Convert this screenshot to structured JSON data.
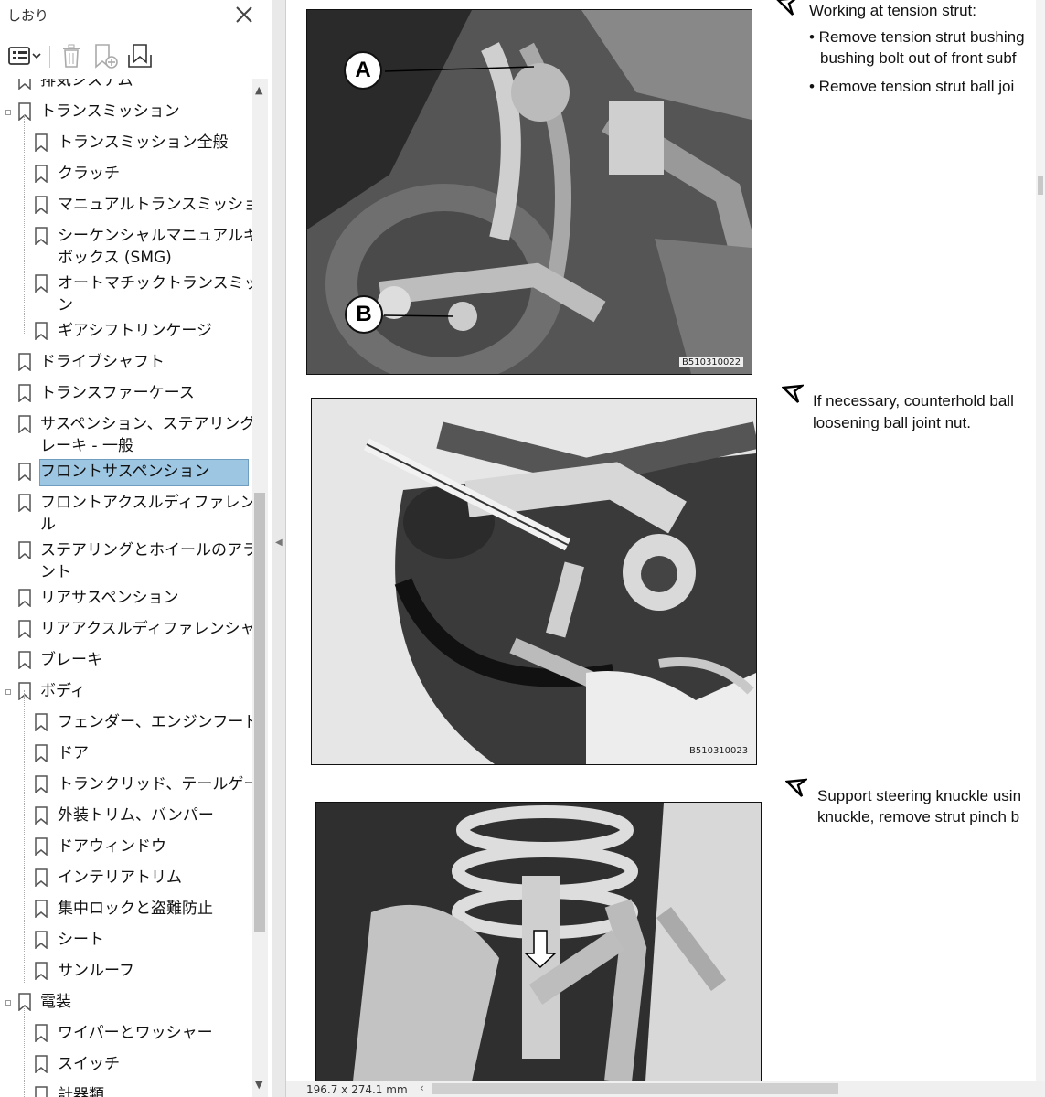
{
  "bookmarks_panel": {
    "title": "しおり",
    "close_icon": "close-icon",
    "toolbar": [
      "options-menu-icon",
      "delete-bookmark-icon",
      "new-bookmark-icon",
      "expand-bookmark-icon"
    ],
    "items": [
      {
        "label": "トランスミッション",
        "level": 0,
        "expandable": true
      },
      {
        "label": "トランスミッション全般",
        "level": 1
      },
      {
        "label": "クラッチ",
        "level": 1
      },
      {
        "label": "マニュアルトランスミッション",
        "level": 1
      },
      {
        "label": "シーケンシャルマニュアルギア",
        "label2": "ボックス (SMG)",
        "level": 1
      },
      {
        "label": "オートマチックトランスミッショ",
        "label2": "ン",
        "level": 1
      },
      {
        "label": "ギアシフトリンケージ",
        "level": 1
      },
      {
        "label": "ドライブシャフト",
        "level": 0
      },
      {
        "label": "トランスファーケース",
        "level": 0
      },
      {
        "label": "サスペンション、ステアリング、ブ",
        "label2": "レーキ - 一般",
        "level": 0
      },
      {
        "label": "フロントサスペンション",
        "level": 0,
        "selected": true
      },
      {
        "label": "フロントアクスルディファレンシャ",
        "label2": "ル",
        "level": 0
      },
      {
        "label": "ステアリングとホイールのアライメ",
        "label2": "ント",
        "level": 0
      },
      {
        "label": "リアサスペンション",
        "level": 0
      },
      {
        "label": "リアアクスルディファレンシャル",
        "level": 0
      },
      {
        "label": "ブレーキ",
        "level": 0
      },
      {
        "label": "ボディ",
        "level": 0,
        "expandable": true
      },
      {
        "label": "フェンダー、エンジンフード",
        "level": 1
      },
      {
        "label": "ドア",
        "level": 1
      },
      {
        "label": "トランクリッド、テールゲート",
        "level": 1
      },
      {
        "label": "外装トリム、バンパー",
        "level": 1
      },
      {
        "label": "ドアウィンドウ",
        "level": 1
      },
      {
        "label": "インテリアトリム",
        "level": 1
      },
      {
        "label": "集中ロックと盗難防止",
        "level": 1
      },
      {
        "label": "シート",
        "level": 1
      },
      {
        "label": "サンルーフ",
        "level": 1
      },
      {
        "label": "電装",
        "level": 0,
        "expandable": true
      },
      {
        "label": "ワイパーとワッシャー",
        "level": 1
      },
      {
        "label": "スイッチ",
        "level": 1
      },
      {
        "label": "計器類",
        "level": 1
      }
    ]
  },
  "document": {
    "figures": [
      {
        "code": "B510310022",
        "callouts": [
          "A",
          "B"
        ]
      },
      {
        "code": "B510310023",
        "callouts": []
      },
      {
        "code": "",
        "callouts": []
      }
    ],
    "steps": [
      {
        "line1": "Working at tension strut:"
      },
      {
        "line1": "• Remove tension strut bushing",
        "line2": "bushing bolt out of front subf"
      },
      {
        "line1": "• Remove tension strut ball joi"
      },
      {
        "line1": "If necessary, counterhold ball",
        "line2": "loosening ball joint nut."
      },
      {
        "line1": "Support steering knuckle usin",
        "line2": "knuckle, remove strut pinch b"
      }
    ]
  },
  "status_bar": {
    "page_size": "196.7 x 274.1 mm"
  }
}
